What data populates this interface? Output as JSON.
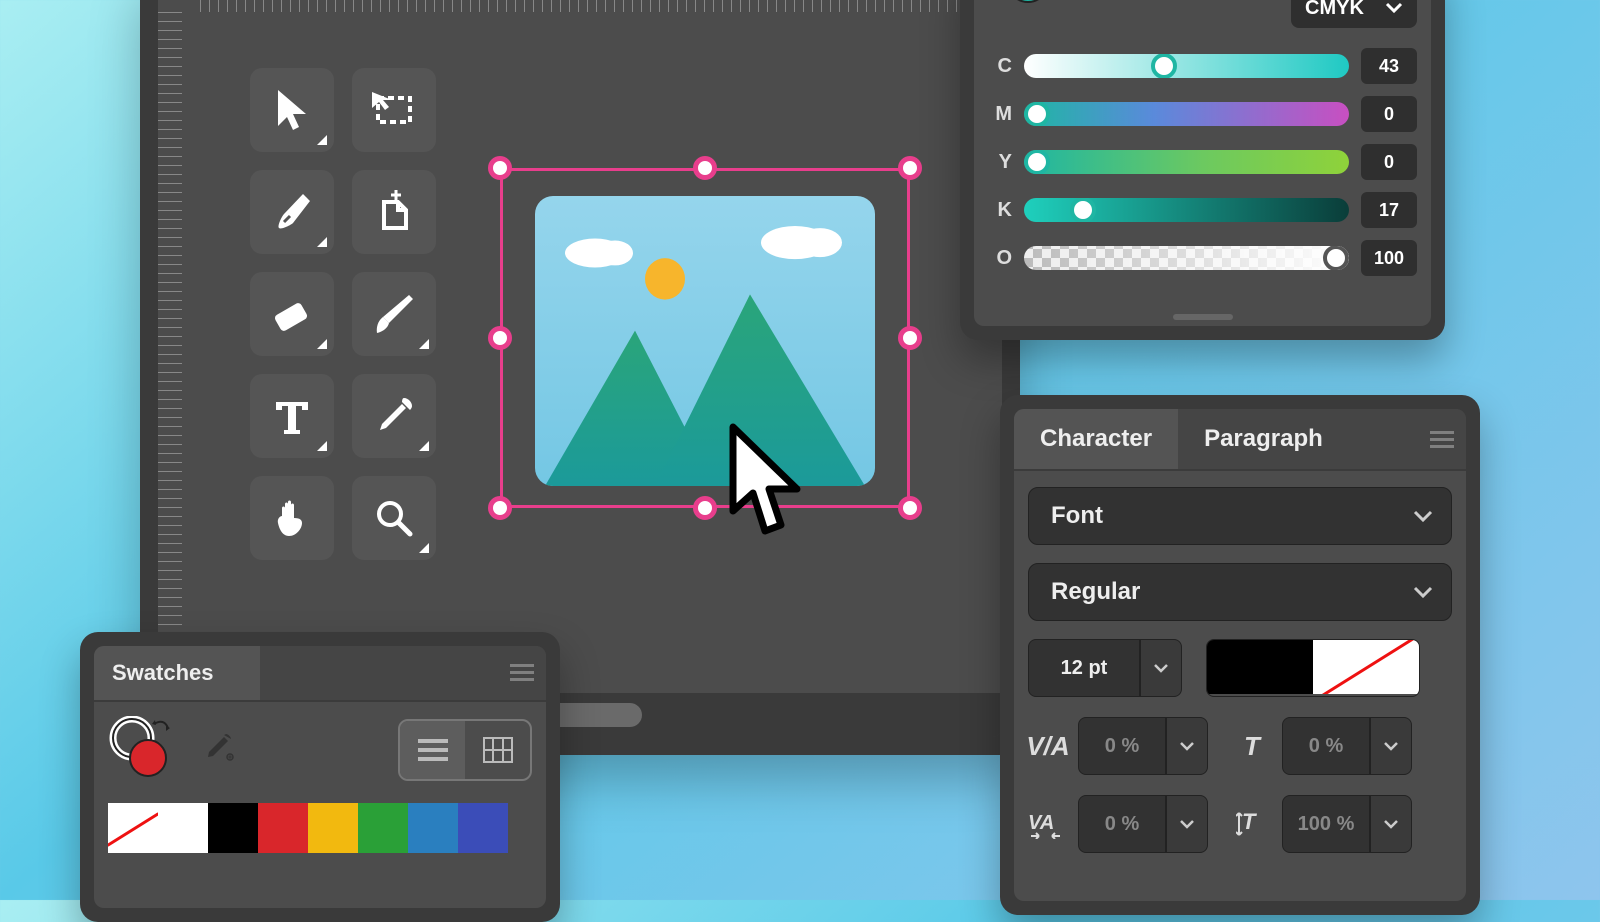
{
  "tools": [
    {
      "name": "selection-tool"
    },
    {
      "name": "artboard-tool"
    },
    {
      "name": "pen-tool"
    },
    {
      "name": "new-document-tool"
    },
    {
      "name": "eraser-tool"
    },
    {
      "name": "brush-tool"
    },
    {
      "name": "type-tool"
    },
    {
      "name": "eyedropper-tool"
    },
    {
      "name": "hand-tool"
    },
    {
      "name": "zoom-tool"
    }
  ],
  "color_panel": {
    "mode_label": "CMYK",
    "current_fill": "#1fb6a3",
    "sliders": {
      "C": {
        "value": 43
      },
      "M": {
        "value": 0
      },
      "Y": {
        "value": 0
      },
      "K": {
        "value": 17
      },
      "O": {
        "value": 100
      }
    }
  },
  "swatches_panel": {
    "title": "Swatches",
    "current_fill": "#e11",
    "colors": [
      "none",
      "#ffffff",
      "#000000",
      "#d9262b",
      "#f2b90f",
      "#2aa037",
      "#2a7fbf",
      "#3b4db8"
    ]
  },
  "character_panel": {
    "tabs": {
      "active": "Character",
      "other": "Paragraph"
    },
    "font_label": "Font",
    "weight_label": "Regular",
    "size_label": "12 pt",
    "fill_color": "#000000",
    "stroke_color": "none",
    "kerning_label": "0 %",
    "horizontal_scale_label": "0 %",
    "tracking_label": "0 %",
    "vertical_scale_label": "100 %",
    "kerning_icon": "V/A",
    "tracking_icon": "VA",
    "hscale_icon": "T",
    "vscale_icon": "T"
  }
}
